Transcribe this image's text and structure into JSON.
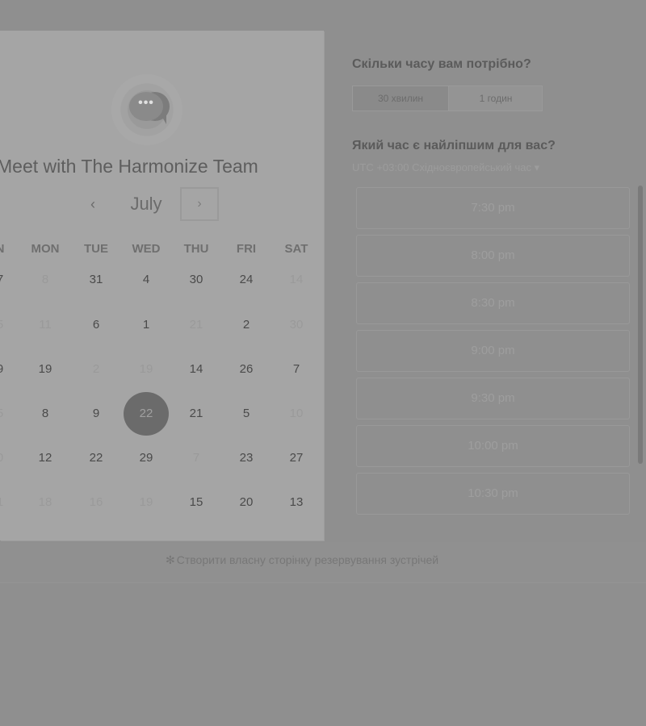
{
  "calendar": {
    "logo_dots": "•••",
    "title": "Meet with The Harmonize Team",
    "month": "July",
    "prev_label": "‹",
    "next_label": "›",
    "days_of_week": [
      "N",
      "MON",
      "TUE",
      "WED",
      "THU",
      "FRI",
      "SAT"
    ],
    "weeks": [
      [
        {
          "d": "7",
          "f": false
        },
        {
          "d": "8",
          "f": true
        },
        {
          "d": "31",
          "f": false
        },
        {
          "d": "4",
          "f": false
        },
        {
          "d": "30",
          "f": false
        },
        {
          "d": "24",
          "f": false
        },
        {
          "d": "14",
          "f": true
        }
      ],
      [
        {
          "d": "5",
          "f": true
        },
        {
          "d": "11",
          "f": true
        },
        {
          "d": "6",
          "f": false
        },
        {
          "d": "1",
          "f": false
        },
        {
          "d": "21",
          "f": true
        },
        {
          "d": "2",
          "f": false
        },
        {
          "d": "30",
          "f": true
        }
      ],
      [
        {
          "d": "9",
          "f": false
        },
        {
          "d": "19",
          "f": false
        },
        {
          "d": "2",
          "f": true
        },
        {
          "d": "19",
          "f": true
        },
        {
          "d": "14",
          "f": false
        },
        {
          "d": "26",
          "f": false
        },
        {
          "d": "7",
          "f": false
        }
      ],
      [
        {
          "d": "5",
          "f": true
        },
        {
          "d": "8",
          "f": false
        },
        {
          "d": "9",
          "f": false
        },
        {
          "d": "22",
          "f": false,
          "s": true
        },
        {
          "d": "21",
          "f": false
        },
        {
          "d": "5",
          "f": false
        },
        {
          "d": "10",
          "f": true
        }
      ],
      [
        {
          "d": "0",
          "f": true
        },
        {
          "d": "12",
          "f": false
        },
        {
          "d": "22",
          "f": false
        },
        {
          "d": "29",
          "f": false
        },
        {
          "d": "7",
          "f": true
        },
        {
          "d": "23",
          "f": false
        },
        {
          "d": "27",
          "f": false
        }
      ],
      [
        {
          "d": "1",
          "f": true
        },
        {
          "d": "18",
          "f": true
        },
        {
          "d": "16",
          "f": true
        },
        {
          "d": "19",
          "f": true
        },
        {
          "d": "15",
          "f": false
        },
        {
          "d": "20",
          "f": false
        },
        {
          "d": "13",
          "f": false
        }
      ]
    ]
  },
  "booking": {
    "duration_question": "Скільки часу вам потрібно?",
    "durations": [
      "30 хвилин",
      "1 годин"
    ],
    "selected_duration": "30 хвилин",
    "time_question": "Який час є найліпшим для вас?",
    "timezone": "UTC +03:00 Східноєвропейський час ▾",
    "slots": [
      "7:30 pm",
      "8:00 pm",
      "8:30 pm",
      "9:00 pm",
      "9:30 pm",
      "10:00 pm",
      "10:30 pm"
    ]
  },
  "footer": {
    "icon": "sprocket-icon",
    "link": "Створити власну сторінку резервування зустрічей"
  }
}
